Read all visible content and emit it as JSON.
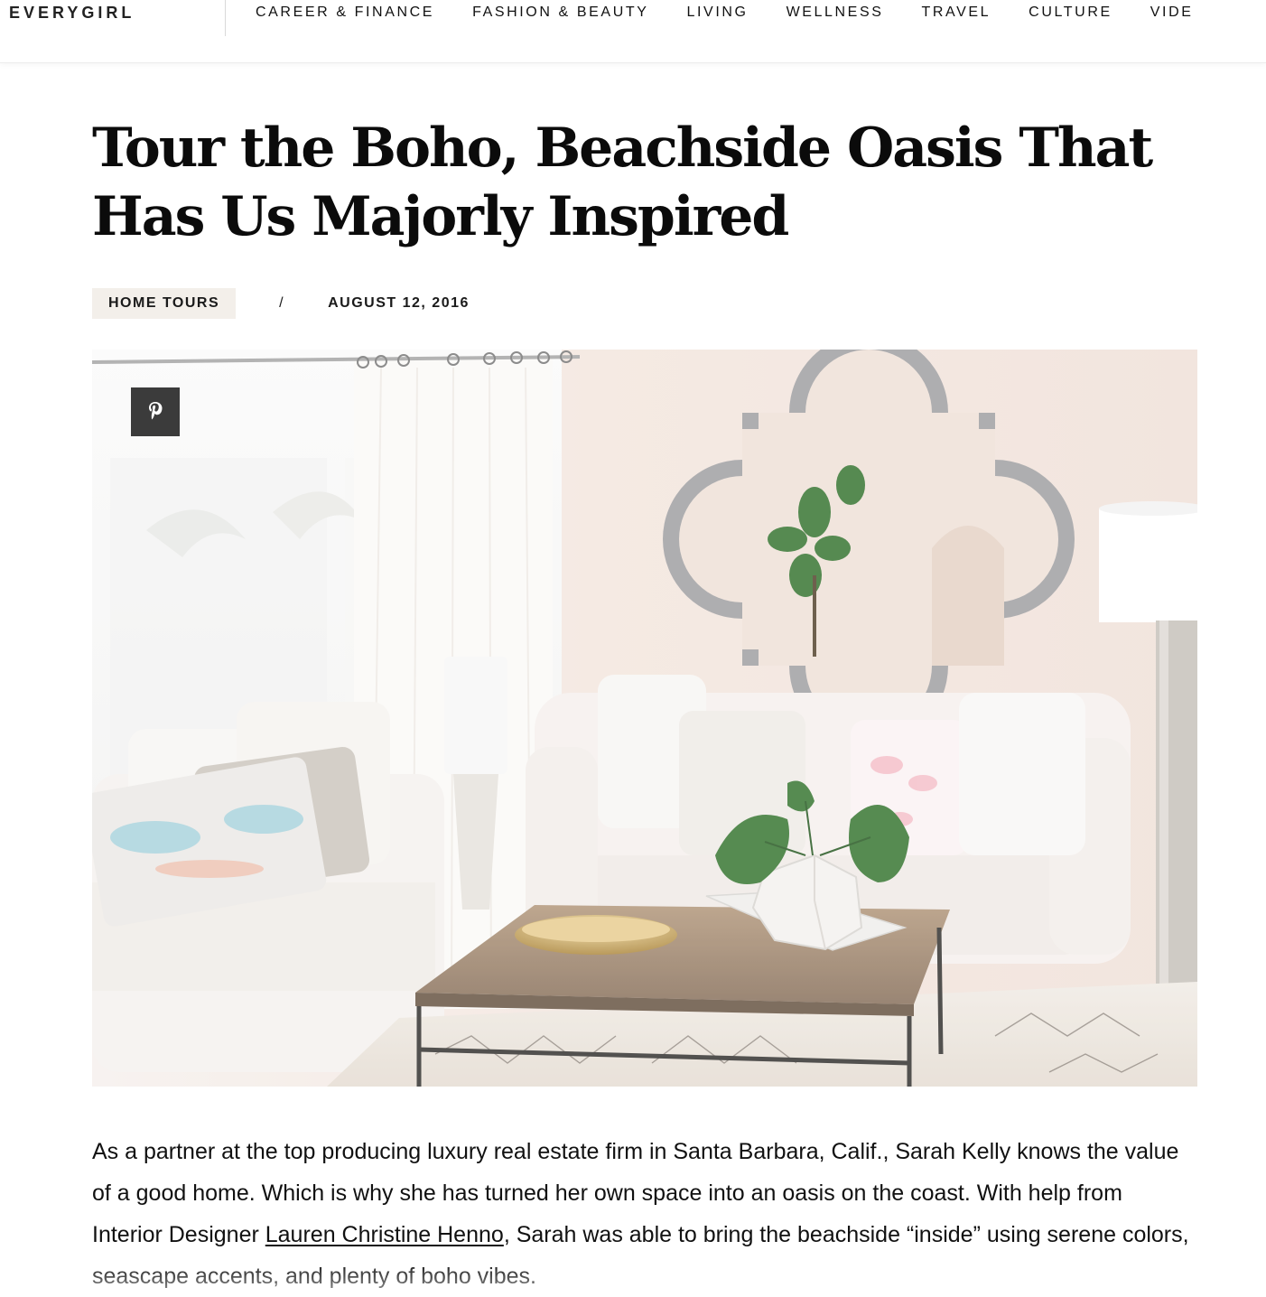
{
  "header": {
    "logo": "EVERYGIRL",
    "nav": [
      {
        "label": "CAREER & FINANCE"
      },
      {
        "label": "FASHION & BEAUTY"
      },
      {
        "label": "LIVING"
      },
      {
        "label": "WELLNESS"
      },
      {
        "label": "TRAVEL"
      },
      {
        "label": "CULTURE"
      },
      {
        "label": "VIDE"
      }
    ]
  },
  "article": {
    "title_line1": "Tour the Boho, Beachside Oasis That",
    "title_line2": "Has Us Majorly Inspired",
    "category": "HOME TOURS",
    "separator": "/",
    "date": "AUGUST 12, 2016",
    "pin_icon": "pinterest-icon",
    "body": {
      "part1": "As a partner at the top producing luxury real estate firm in Santa Barbara, Calif., Sarah Kelly knows the value of a good home. Which is why she has turned her own space into an oasis on the coast. With help from Interior Designer ",
      "link": "Lauren Christine Henno",
      "part2": ", Sarah was able to bring the beachside “inside” using serene colors, seascape accents, and plenty of boho vibes."
    }
  },
  "colors": {
    "pin_button": "#3b3b3b",
    "category_bg": "#f3efea",
    "wall": "#f3e6df"
  }
}
